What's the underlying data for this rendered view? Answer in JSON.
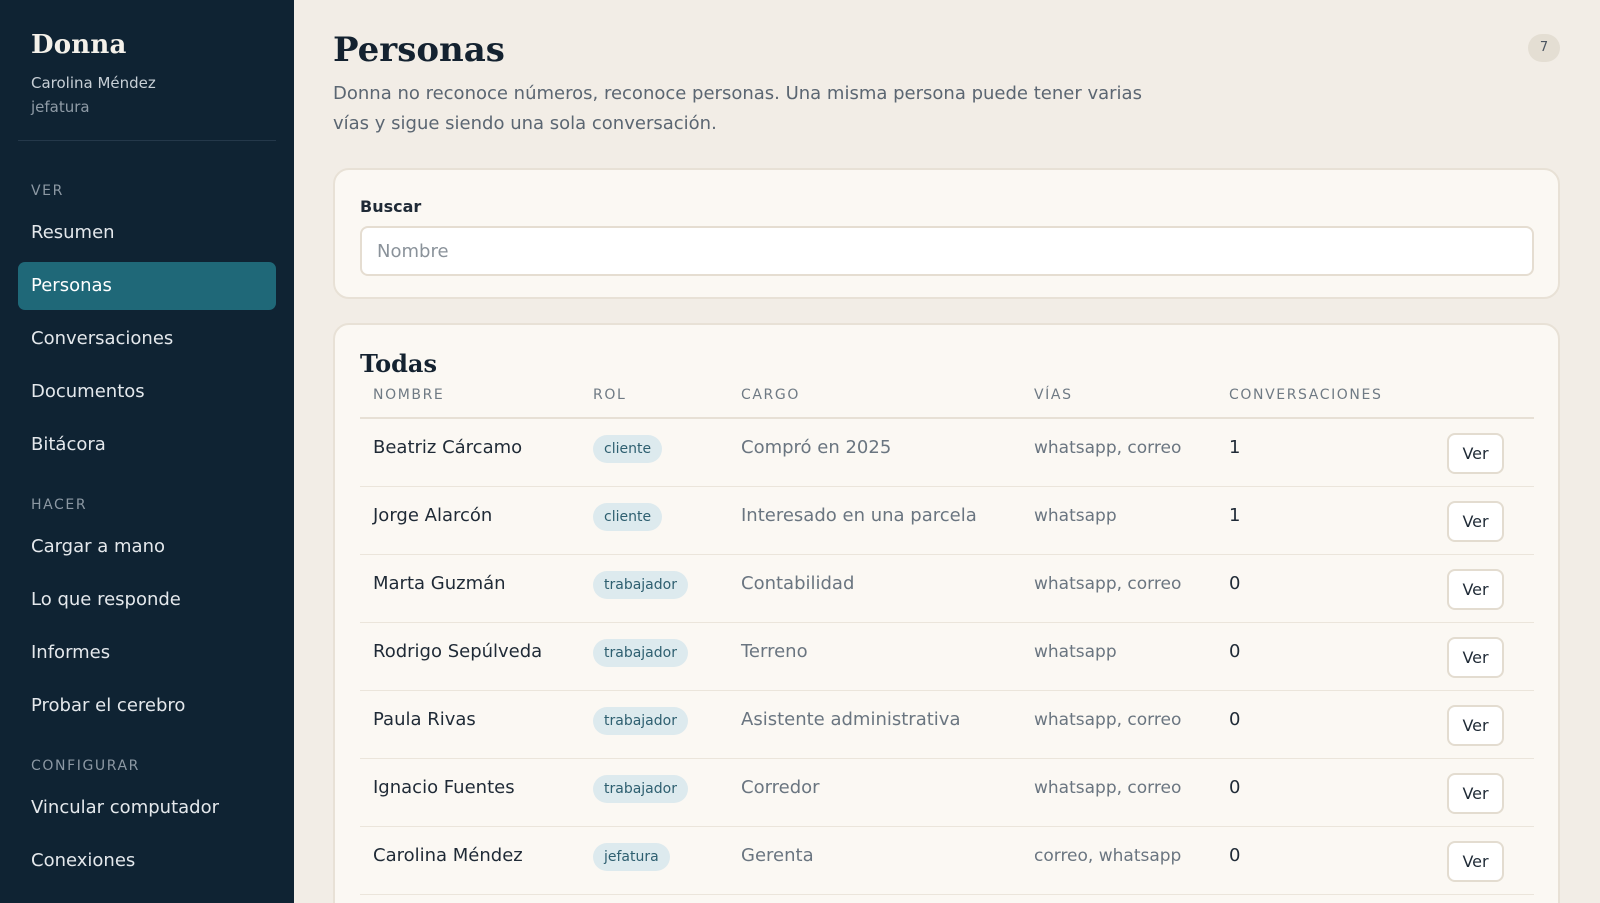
{
  "sidebar": {
    "brand": "Donna",
    "user_name": "Carolina Méndez",
    "user_role": "jefatura",
    "sections": {
      "ver": "VER",
      "hacer": "HACER",
      "configurar": "CONFIGURAR"
    },
    "items": {
      "resumen": "Resumen",
      "personas": "Personas",
      "conversaciones": "Conversaciones",
      "documentos": "Documentos",
      "bitacora": "Bitácora",
      "cargar": "Cargar a mano",
      "responde": "Lo que responde",
      "informes": "Informes",
      "probar": "Probar el cerebro",
      "vincular": "Vincular computador",
      "conexiones": "Conexiones"
    },
    "active_item": "personas"
  },
  "header": {
    "title": "Personas",
    "count": "7",
    "description": "Donna no reconoce números, reconoce personas. Una misma persona puede tener varias vías y sigue siendo una sola conversación."
  },
  "search": {
    "label": "Buscar",
    "placeholder": "Nombre",
    "value": ""
  },
  "table": {
    "title": "Todas",
    "columns": {
      "nombre": "NOMBRE",
      "rol": "ROL",
      "cargo": "CARGO",
      "vias": "VÍAS",
      "conversaciones": "CONVERSACIONES"
    },
    "action_label": "Ver",
    "rows": [
      {
        "nombre": "Beatriz Cárcamo",
        "rol": "cliente",
        "cargo": "Compró en 2025",
        "vias": "whatsapp, correo",
        "conversaciones": "1"
      },
      {
        "nombre": "Jorge Alarcón",
        "rol": "cliente",
        "cargo": "Interesado en una parcela",
        "vias": "whatsapp",
        "conversaciones": "1"
      },
      {
        "nombre": "Marta Guzmán",
        "rol": "trabajador",
        "cargo": "Contabilidad",
        "vias": "whatsapp, correo",
        "conversaciones": "0"
      },
      {
        "nombre": "Rodrigo Sepúlveda",
        "rol": "trabajador",
        "cargo": "Terreno",
        "vias": "whatsapp",
        "conversaciones": "0"
      },
      {
        "nombre": "Paula Rivas",
        "rol": "trabajador",
        "cargo": "Asistente administrativa",
        "vias": "whatsapp, correo",
        "conversaciones": "0"
      },
      {
        "nombre": "Ignacio Fuentes",
        "rol": "trabajador",
        "cargo": "Corredor",
        "vias": "whatsapp, correo",
        "conversaciones": "0"
      },
      {
        "nombre": "Carolina Méndez",
        "rol": "jefatura",
        "cargo": "Gerenta",
        "vias": "correo, whatsapp",
        "conversaciones": "0"
      }
    ]
  },
  "colors": {
    "sidebar_bg": "#0f2333",
    "active_item": "#1f6878",
    "page_bg": "#f2ede6",
    "tag_bg": "#ddeaee",
    "tag_text": "#2e5f70"
  }
}
